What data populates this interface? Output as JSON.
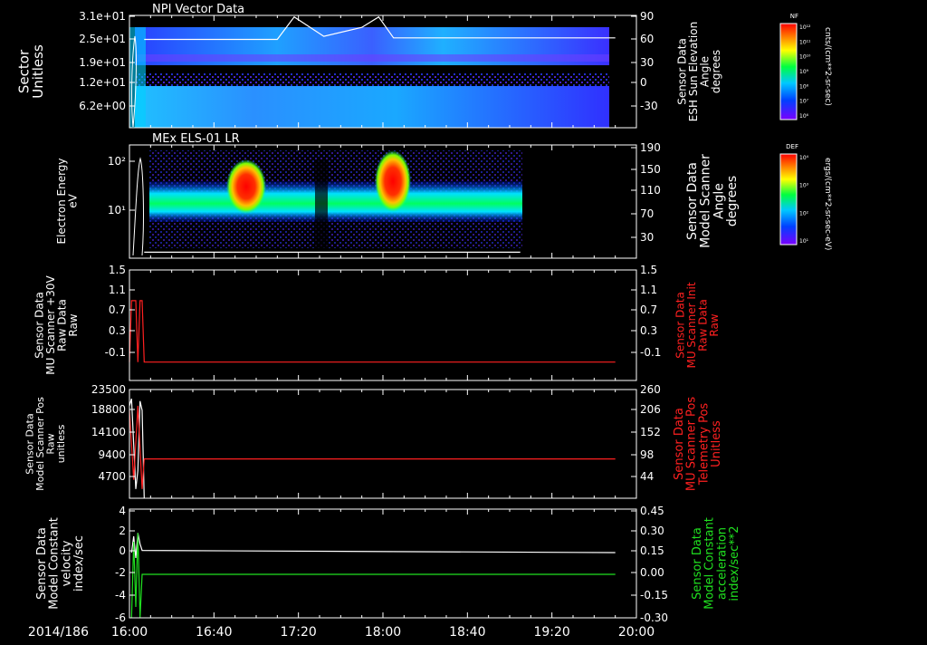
{
  "date_label": "2014/186",
  "time_axis": {
    "start": "16:00",
    "end": "20:00",
    "tick_labels": [
      "16:00",
      "16:40",
      "17:20",
      "18:00",
      "18:40",
      "19:20",
      "20:00"
    ]
  },
  "colors": {
    "background": "#000000",
    "axis": "#ffffff",
    "trace_white": "#ffffff",
    "trace_red": "#ff2020",
    "trace_green": "#20e020",
    "label_red": "#ff2020",
    "label_green": "#20e020"
  },
  "chart_data": [
    {
      "type": "heatmap",
      "title": "NPI Vector Data",
      "ylabel": [
        "Sector",
        "Unitless"
      ],
      "yticks": [
        "3.1e+01",
        "2.5e+01",
        "1.9e+01",
        "1.2e+01",
        "6.2e+00"
      ],
      "right_ylabel": [
        "Sensor Data",
        "ESH Sun Elevation",
        "Angle",
        "degrees"
      ],
      "right_yticks": [
        "90",
        "60",
        "30",
        "0",
        "-30"
      ],
      "right_ylim": [
        -60,
        90
      ],
      "colorbar": {
        "label": "NF",
        "units": "cnts/(cm**2-sr-sec)",
        "ticks": [
          "10¹²",
          "10¹¹",
          "10¹⁰",
          "10⁹",
          "10⁸",
          "10⁷",
          "10⁶"
        ]
      },
      "overlay_series": {
        "name": "",
        "color": "white",
        "points": [
          [
            "16:07",
            58
          ],
          [
            "17:10",
            58
          ],
          [
            "17:18",
            88
          ],
          [
            "17:32",
            62
          ],
          [
            "17:50",
            74
          ],
          [
            "17:58",
            88
          ],
          [
            "18:05",
            60
          ],
          [
            "19:50",
            60
          ]
        ]
      }
    },
    {
      "type": "heatmap",
      "title": "MEx ELS-01 LR",
      "ylabel": [
        "Electron Energy",
        "eV"
      ],
      "yticks": [
        "10²",
        "10¹"
      ],
      "right_ylabel": [
        "Sensor Data",
        "Model Scanner",
        "Angle",
        "degrees"
      ],
      "right_yticks": [
        "190",
        "150",
        "110",
        "70",
        "30"
      ],
      "right_ylim": [
        0,
        190
      ],
      "colorbar": {
        "label": "DEF",
        "units": "ergs/(cm**2-sr-sec-eV)",
        "ticks": [
          "10⁴",
          "10³",
          "10²",
          "10¹"
        ]
      },
      "overlay_series": {
        "name": "",
        "color": "white",
        "points": [
          [
            "16:07",
            10
          ],
          [
            "19:05",
            10
          ]
        ]
      }
    },
    {
      "type": "line",
      "ylabel": [
        "Sensor Data",
        "MU Scanner +30V",
        "Raw Data",
        "Raw"
      ],
      "yticks": [
        "1.5",
        "1.1",
        "0.7",
        "0.3",
        "-0.1"
      ],
      "ylim": [
        -0.3,
        1.5
      ],
      "right_ylabel": [
        "Sensor Data",
        "MU Scanner Init",
        "Raw Data",
        "Raw"
      ],
      "right_yticks": [
        "1.5",
        "1.1",
        "0.7",
        "0.3",
        "-0.1"
      ],
      "series": [
        {
          "name": "",
          "color": "red",
          "points": [
            [
              "16:00",
              0.0
            ],
            [
              "16:01",
              1.0
            ],
            [
              "16:03",
              1.0
            ],
            [
              "16:04",
              0.0
            ],
            [
              "16:05",
              1.0
            ],
            [
              "16:06",
              1.0
            ],
            [
              "16:07",
              0.0
            ],
            [
              "19:50",
              0.0
            ]
          ]
        }
      ]
    },
    {
      "type": "line",
      "ylabel": [
        "Sensor Data",
        "Model Scanner Pos",
        "Raw",
        "unitless"
      ],
      "yticks": [
        "23500",
        "18800",
        "14100",
        "9400",
        "4700"
      ],
      "ylim": [
        0,
        23500
      ],
      "right_ylabel": [
        "Sensor Data",
        "MU Scanner Pos",
        "Telemetry Pos",
        "Unitless"
      ],
      "right_yticks": [
        "260",
        "206",
        "152",
        "98",
        "44"
      ],
      "series": [
        {
          "name": "",
          "color": "white",
          "points": [
            [
              "16:00",
              20000
            ],
            [
              "16:01",
              21500
            ],
            [
              "16:03",
              2000
            ],
            [
              "16:04",
              6000
            ],
            [
              "16:05",
              21000
            ],
            [
              "16:06",
              19000
            ],
            [
              "16:07",
              0
            ]
          ]
        },
        {
          "name": "",
          "color": "red",
          "points": [
            [
              "16:00",
              19000
            ],
            [
              "16:02",
              4000
            ],
            [
              "16:04",
              20000
            ],
            [
              "16:06",
              2000
            ],
            [
              "16:07",
              8500
            ],
            [
              "19:50",
              8500
            ]
          ]
        }
      ]
    },
    {
      "type": "line",
      "ylabel": [
        "Sensor Data",
        "Model Constant",
        "velocity",
        "index/sec"
      ],
      "yticks": [
        "4",
        "2",
        "0",
        "-2",
        "-4",
        "-6"
      ],
      "ylim": [
        -6,
        4
      ],
      "right_ylabel": [
        "Sensor Data",
        "Model Constant",
        "acceleration",
        "index/sec**2"
      ],
      "right_yticks": [
        "0.45",
        "0.30",
        "0.15",
        "0.00",
        "-0.15",
        "-0.30"
      ],
      "series": [
        {
          "name": "",
          "color": "white",
          "points": [
            [
              "16:01",
              0.0
            ],
            [
              "16:02",
              1.5
            ],
            [
              "16:03",
              -0.5
            ],
            [
              "16:04",
              1.8
            ],
            [
              "16:05",
              0.8
            ],
            [
              "16:06",
              0.2
            ],
            [
              "19:50",
              0.0
            ]
          ]
        },
        {
          "name": "",
          "color": "green",
          "points": [
            [
              "16:01",
              -6
            ],
            [
              "16:02",
              1.0
            ],
            [
              "16:03",
              -5
            ],
            [
              "16:04",
              1.8
            ],
            [
              "16:05",
              -6
            ],
            [
              "16:06",
              -2
            ],
            [
              "19:50",
              -2
            ]
          ]
        }
      ]
    }
  ]
}
